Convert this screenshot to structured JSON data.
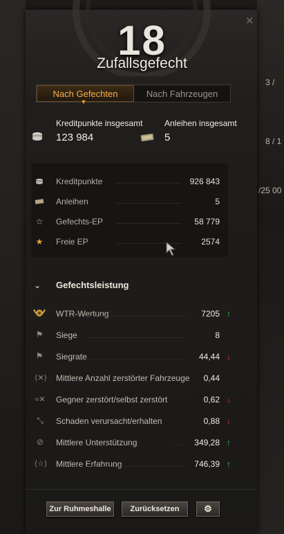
{
  "header": {
    "battle_count": "18",
    "mode_title": "Zufallsgefecht"
  },
  "tabs": [
    {
      "label": "Nach Gefechten",
      "active": true
    },
    {
      "label": "Nach Fahrzeugen",
      "active": false
    }
  ],
  "totals": {
    "credits_label": "Kreditpunkte insgesamt",
    "credits_value": "123 984",
    "bonds_label": "Anleihen insgesamt",
    "bonds_value": "5"
  },
  "summary": [
    {
      "icon": "credits-icon",
      "label": "Kreditpunkte",
      "value": "926 843"
    },
    {
      "icon": "bonds-icon",
      "label": "Anleihen",
      "value": "5"
    },
    {
      "icon": "battle-xp-icon",
      "label": "Gefechts-EP",
      "value": "58 779"
    },
    {
      "icon": "free-xp-icon",
      "label": "Freie EP",
      "value": "2574"
    }
  ],
  "performance": {
    "title": "Gefechtsleistung",
    "rows": [
      {
        "icon": "wtr-rating-icon",
        "label": "WTR-Wertung",
        "value": "7205",
        "trend": "up"
      },
      {
        "icon": "victories-flag-icon",
        "label": "Siege",
        "value": "8",
        "trend": ""
      },
      {
        "icon": "win-rate-flag-icon",
        "label": "Siegrate",
        "value": "44,44",
        "trend": "down"
      },
      {
        "icon": "destroyed-vehicles-icon",
        "label": "Mittlere Anzahl zerstörter Fahrzeuge",
        "value": "0,44",
        "trend": ""
      },
      {
        "icon": "kill-death-icon",
        "label": "Gegner zerstört/selbst zerstört",
        "value": "0,62",
        "trend": "down"
      },
      {
        "icon": "damage-ratio-icon",
        "label": "Schaden verursacht/erhalten",
        "value": "0,88",
        "trend": "down"
      },
      {
        "icon": "assist-icon",
        "label": "Mittlere Unterstützung",
        "value": "349,28",
        "trend": "up"
      },
      {
        "icon": "avg-xp-icon",
        "label": "Mittlere Erfahrung",
        "value": "746,39",
        "trend": "up"
      }
    ]
  },
  "buttons": {
    "hall_of_fame": "Zur Ruhmeshalle",
    "reset": "Zurücksetzen"
  },
  "background_fragments": [
    "3 /",
    "8 / 1",
    "/25 00"
  ]
}
